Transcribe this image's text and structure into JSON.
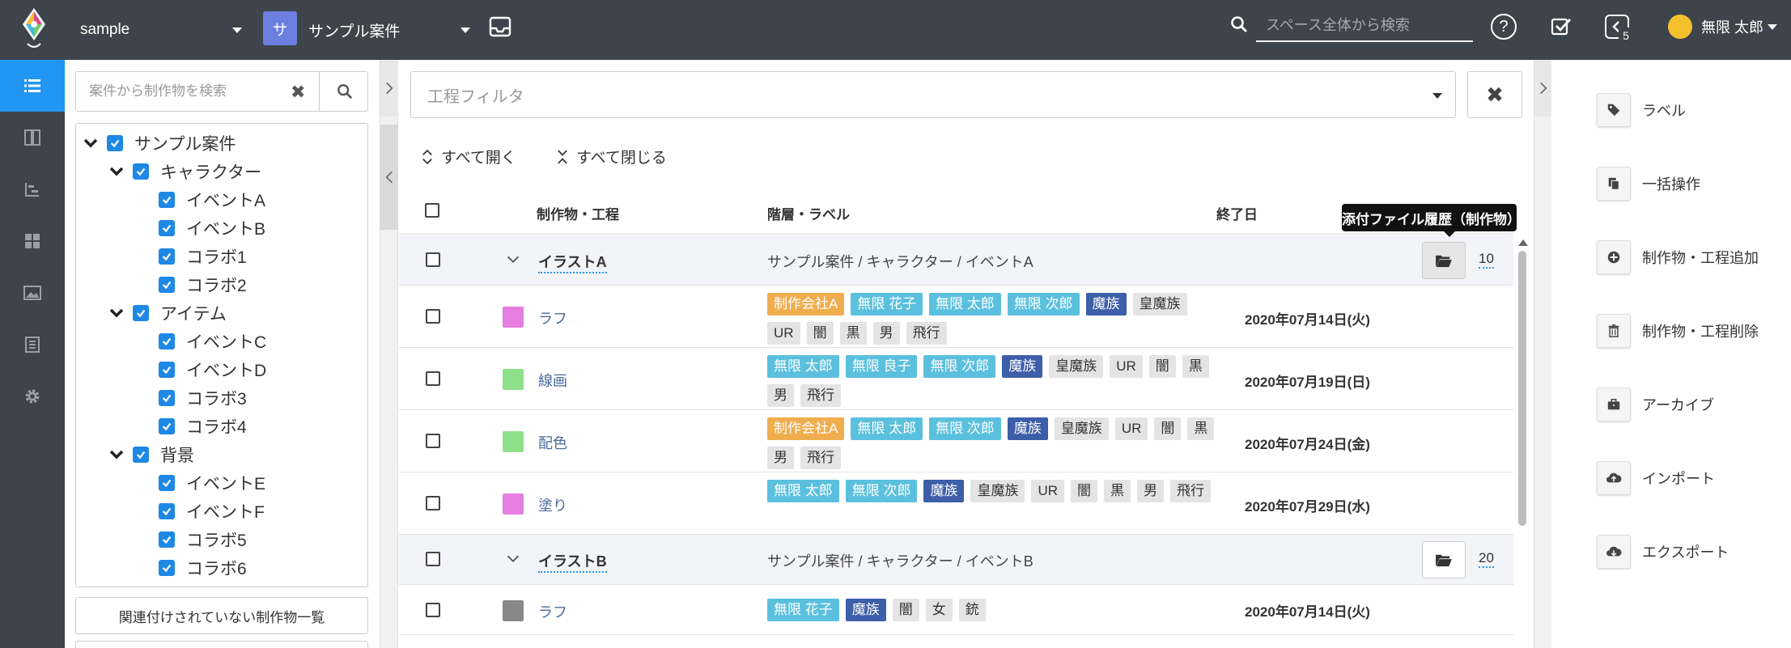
{
  "header": {
    "space_name": "sample",
    "project_initial": "サ",
    "project_name": "サンプル案件",
    "search_placeholder": "スペース全体から検索",
    "help_label": "?",
    "notification_count": "5",
    "user_name": "無限 太郎"
  },
  "colors": {
    "topbar": "#3e444b",
    "accent": "#2196f3",
    "tag_orange": "#f0ad4e",
    "tag_cyan": "#5bc0de",
    "tag_navy": "#3d5ea8",
    "tag_gray": "#e4e4e4"
  },
  "nav_icons": [
    "list-icon",
    "board-icon",
    "gantt-icon",
    "grid-icon",
    "image-icon",
    "document-icon",
    "gear-icon"
  ],
  "tree": {
    "search_placeholder": "案件から制作物を検索",
    "clear_label": "✖",
    "root": "サンプル案件",
    "groups": [
      {
        "name": "キャラクター",
        "items": [
          "イベントA",
          "イベントB",
          "コラボ1",
          "コラボ2"
        ]
      },
      {
        "name": "アイテム",
        "items": [
          "イベントC",
          "イベントD",
          "コラボ3",
          "コラボ4"
        ]
      },
      {
        "name": "背景",
        "items": [
          "イベントE",
          "イベントF",
          "コラボ5",
          "コラボ6"
        ]
      }
    ],
    "unlinked_label": "関連付けされていない制作物一覧"
  },
  "main": {
    "filter_placeholder": "工程フィルタ",
    "filter_clear": "✖",
    "expand_all": "すべて開く",
    "collapse_all": "すべて閉じる",
    "columns": {
      "name": "制作物・工程",
      "path": "階層・ラベル",
      "end": "終了日"
    },
    "tooltip": "添付ファイル履歴（制作物）",
    "rows": [
      {
        "type": "parent",
        "name": "イラストA",
        "path": "サンプル案件 / キャラクター / イベントA",
        "count": "10"
      },
      {
        "type": "step",
        "name": "ラフ",
        "color": "#e57ee0",
        "end": "2020年07月14日(火)",
        "labels": [
          {
            "t": "制作会社A",
            "c": "orange"
          },
          {
            "t": "無限 花子",
            "c": "cyan"
          },
          {
            "t": "無限 太郎",
            "c": "cyan"
          },
          {
            "t": "無限 次郎",
            "c": "cyan"
          },
          {
            "t": "魔族",
            "c": "navy"
          },
          {
            "t": "皇魔族",
            "c": "gray"
          },
          {
            "t": "UR",
            "c": "gray"
          },
          {
            "t": "闇",
            "c": "gray"
          },
          {
            "t": "黒",
            "c": "gray"
          },
          {
            "t": "男",
            "c": "gray"
          },
          {
            "t": "飛行",
            "c": "gray"
          }
        ]
      },
      {
        "type": "step",
        "name": "線画",
        "color": "#8ee08a",
        "end": "2020年07月19日(日)",
        "labels": [
          {
            "t": "無限 太郎",
            "c": "cyan"
          },
          {
            "t": "無限 良子",
            "c": "cyan"
          },
          {
            "t": "無限 次郎",
            "c": "cyan"
          },
          {
            "t": "魔族",
            "c": "navy"
          },
          {
            "t": "皇魔族",
            "c": "gray"
          },
          {
            "t": "UR",
            "c": "gray"
          },
          {
            "t": "闇",
            "c": "gray"
          },
          {
            "t": "黒",
            "c": "gray"
          },
          {
            "t": "男",
            "c": "gray"
          },
          {
            "t": "飛行",
            "c": "gray"
          }
        ]
      },
      {
        "type": "step",
        "name": "配色",
        "color": "#8ee08a",
        "end": "2020年07月24日(金)",
        "labels": [
          {
            "t": "制作会社A",
            "c": "orange"
          },
          {
            "t": "無限 太郎",
            "c": "cyan"
          },
          {
            "t": "無限 次郎",
            "c": "cyan"
          },
          {
            "t": "魔族",
            "c": "navy"
          },
          {
            "t": "皇魔族",
            "c": "gray"
          },
          {
            "t": "UR",
            "c": "gray"
          },
          {
            "t": "闇",
            "c": "gray"
          },
          {
            "t": "黒",
            "c": "gray"
          },
          {
            "t": "男",
            "c": "gray"
          },
          {
            "t": "飛行",
            "c": "gray"
          }
        ]
      },
      {
        "type": "step",
        "name": "塗り",
        "color": "#e57ee0",
        "end": "2020年07月29日(水)",
        "labels": [
          {
            "t": "無限 太郎",
            "c": "cyan"
          },
          {
            "t": "無限 次郎",
            "c": "cyan"
          },
          {
            "t": "魔族",
            "c": "navy"
          },
          {
            "t": "皇魔族",
            "c": "gray"
          },
          {
            "t": "UR",
            "c": "gray"
          },
          {
            "t": "闇",
            "c": "gray"
          },
          {
            "t": "黒",
            "c": "gray"
          },
          {
            "t": "男",
            "c": "gray"
          },
          {
            "t": "飛行",
            "c": "gray"
          }
        ]
      },
      {
        "type": "parent",
        "name": "イラストB",
        "path": "サンプル案件 / キャラクター / イベントB",
        "count": "20"
      },
      {
        "type": "step",
        "name": "ラフ",
        "color": "#888888",
        "end": "2020年07月14日(火)",
        "labels": [
          {
            "t": "無限 花子",
            "c": "cyan"
          },
          {
            "t": "魔族",
            "c": "navy"
          },
          {
            "t": "闇",
            "c": "gray"
          },
          {
            "t": "女",
            "c": "gray"
          },
          {
            "t": "銃",
            "c": "gray"
          }
        ]
      }
    ]
  },
  "actions": [
    {
      "label": "ラベル",
      "icon": "tag-icon"
    },
    {
      "label": "一括操作",
      "icon": "copy-icon"
    },
    {
      "label": "制作物・工程追加",
      "icon": "plus-circle-icon"
    },
    {
      "label": "制作物・工程削除",
      "icon": "trash-icon"
    },
    {
      "label": "アーカイブ",
      "icon": "briefcase-icon"
    },
    {
      "label": "インポート",
      "icon": "cloud-upload-icon"
    },
    {
      "label": "エクスポート",
      "icon": "cloud-download-icon"
    }
  ]
}
